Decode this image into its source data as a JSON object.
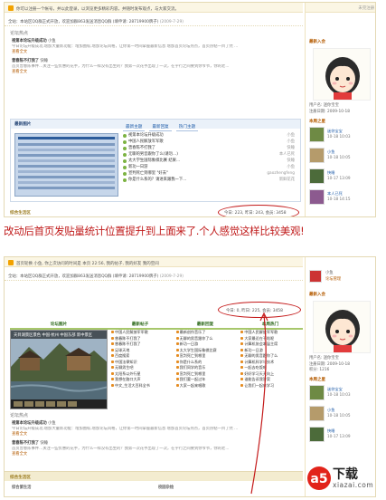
{
  "caption": "改动后首页发贴量统计位置提升到上面来了.个人感觉这样比较美观!",
  "before": {
    "topbar": "你可以注册一个帐号，并以此登录，以浏览更多精彩内容，并随时发布观点，与大家交流。",
    "notice": "全站：本站区QQ群正式开放，欢迎加群863发送消息QQ群 (填申请: 28719900牌子)",
    "notice_date": "(2009-7-29)",
    "section_title": "论坛热点",
    "posts": [
      {
        "title": "视第本论坛升级成功",
        "meta": "小鱼",
        "excerpt": "今日论坛升级成功,增加大量新功能：增加图标,增加论坛风格，让你第一时间掌握最新信息 增加首页论坛热点，首页热帖一目了然 ...",
        "more": "查看全文"
      },
      {
        "title": "曾春陈不打我了",
        "meta": "快睡",
        "excerpt": "首页曾春陈事件…关注一些优惠的花手，为什么一样没有出生的？我第一次花手出现了一次，在宇行之间要到你爷爷，你的老...",
        "more": "查看全文"
      }
    ],
    "image_panel_title": "最新图片",
    "tabs": [
      "最新主题",
      "最新回复",
      "热门主题"
    ],
    "hot_items": [
      {
        "t": "视第本论坛升级成功",
        "a": "小鱼"
      },
      {
        "t": "中国人民解放军军歌",
        "a": "小鱼"
      },
      {
        "t": "曾春陈不打我了",
        "a": "快睡"
      },
      {
        "t": "无聊的男音跟你了么(请勿…)",
        "a": "本人已死"
      },
      {
        "t": "太大学生国际象棋比赛 结果…",
        "a": "快睡"
      },
      {
        "t": "新功一日游",
        "a": "小鱼"
      },
      {
        "t": "宣判死亡到哪里 \"好去\"",
        "a": "gaozhengfeng"
      },
      {
        "t": "你是什么系的？请进来跟我一下…",
        "a": "新鲜花花"
      }
    ],
    "stats": "今日: 223, 昨日: 243, 会员: 3458",
    "group_bar_label": "综合生活区",
    "side_top": "未完注册",
    "side_user_label": "最新入会",
    "side_user_text": [
      "用户名: 迷你宝宝",
      "注册日期: 2009-10-18"
    ],
    "side_section": "本周之星",
    "side_thumbs": [
      {
        "user": "迷你宝宝",
        "date": "10-18 10:03"
      },
      {
        "user": "小鱼",
        "date": "10-18 10:05"
      },
      {
        "user": "快睡",
        "date": "10-17 13:09"
      },
      {
        "user": "本人已死",
        "date": "10-18 14:15"
      }
    ]
  },
  "after": {
    "topbar": "首页轮换 小鱼, 你上次访问的时间是 本页 22:56, 我的帖子, 我的好友 我的空间",
    "notice": "全站：本站区QQ群正式开放，欢迎加群863发送消息QQ群 (填申请: 28719900牌子)",
    "notice_date": "(2009-7-29)",
    "stats": "今日: 0, 昨日: 225, 会员: 3458",
    "forum_tabs": [
      "论坛图片",
      "最新帖子",
      "最新回复",
      "本周热门"
    ],
    "photo_caption": "天目湖景区景色 中国·杭州 中国东部 新中景区",
    "grid_rows": [
      [
        "中国人民解放军军歌",
        "最新创作音乐了",
        "中国人民解放军军歌"
      ],
      [
        "曾春陈不打我了",
        "无聊的男音跟你了么",
        "大家最近在干啥呢"
      ],
      [
        "曾春陈不打我了",
        "新功一日游",
        "计算机协会本届主席"
      ],
      [
        "足球天地",
        "太大学生国际象棋比赛",
        "新功一日游"
      ],
      [
        "百度搜索",
        "宣判死亡到哪里",
        "无聊的男音跟你了么"
      ],
      [
        "中国法律知识",
        "你是什么系的",
        "计算机科学与技术"
      ],
      [
        "无聊男生吧",
        "我们同学的音乐",
        "一起去吃饭吧"
      ],
      [
        "太阳系以外行星",
        "宣判死亡到哪里",
        "好好学习天天向上"
      ],
      [
        "我想在路口大声",
        "我们要一起过年",
        "谁能告诉我答案"
      ],
      [
        "中文_生活大百科全书",
        "大家一起来唱歌",
        "让我们一起来学习"
      ]
    ],
    "section_title": "论坛热点",
    "posts": [
      {
        "title": "视第本论坛升级成功",
        "meta": "小鱼",
        "excerpt": "今日论坛升级成功,增加大量新功能：增加图标,增加论坛风格，让你第一时间掌握最新信息 增加首页论坛热点，首页热帖一目了然 ...",
        "more": "查看全文"
      },
      {
        "title": "曾春陈不打我了",
        "meta": "快睡",
        "excerpt": "首页曾春陈事件…关注一些优惠的花手，为什么一样没有出生的？我第一次花手出现了一次，在宇行之间要到你爷爷，你的老...",
        "more": "查看全文"
      }
    ],
    "group_bar_label": "综合生活区",
    "footer_left": "综合第生活",
    "footer_right": "校园杂烩",
    "side_top_user": "小鱼",
    "side_top_link": "论坛管理",
    "side_user_label": "最新入会",
    "side_user_text": [
      "用户名: 迷你宝宝",
      "注册日期: 2009-10-18",
      "积分: 1216"
    ],
    "side_section": "本周之星",
    "side_thumbs": [
      {
        "user": "迷你宝宝",
        "date": "10-18 10:03"
      },
      {
        "user": "小鱼",
        "date": "10-18 10:05"
      },
      {
        "user": "快睡",
        "date": "10-17 13:09"
      }
    ]
  },
  "watermark": {
    "brand": "下载",
    "url": "xiazai.com"
  }
}
